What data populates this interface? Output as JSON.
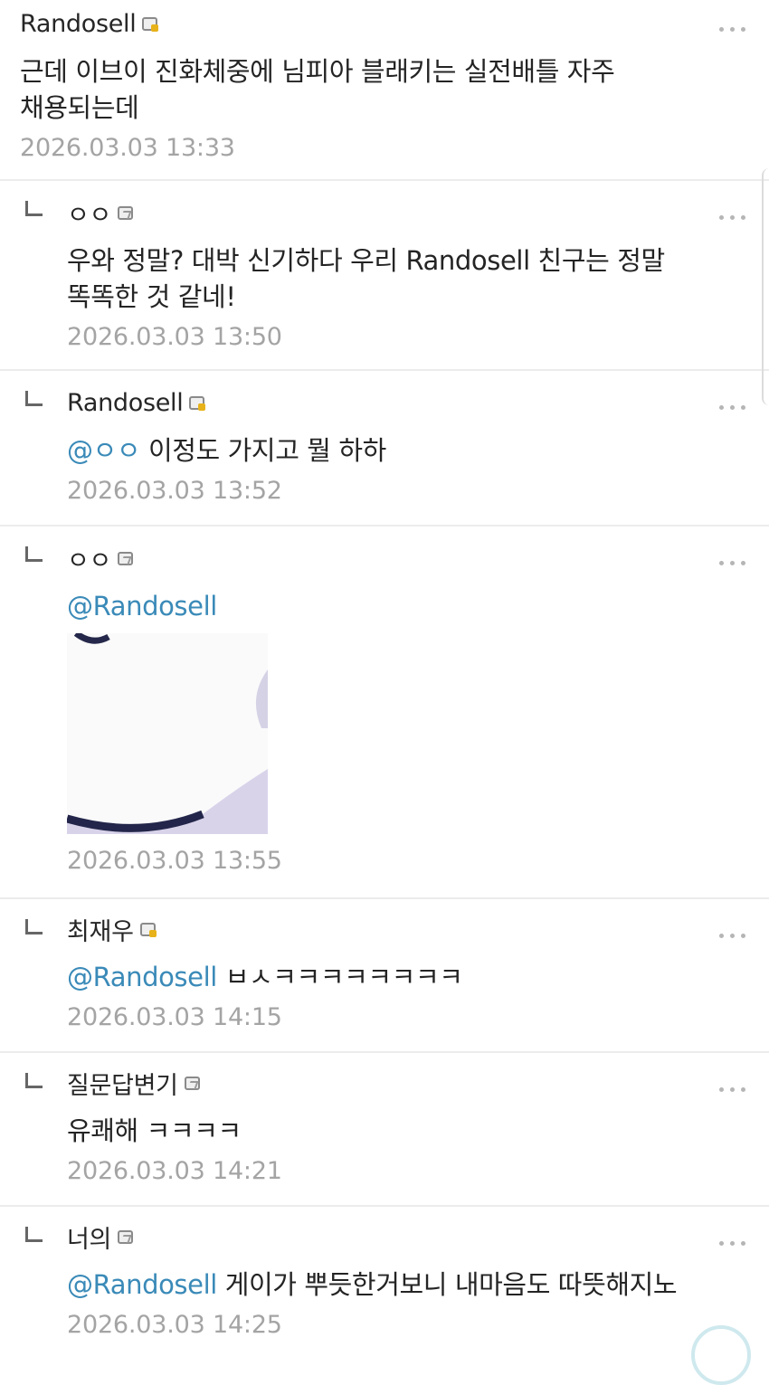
{
  "comments": [
    {
      "name": "Randosell",
      "badge": "fixed",
      "text": "근데 이브이 진화체중에 님피아 블래키는 실전배틀 자주 채용되는데",
      "mention": "",
      "time": "2026.03.03 13:33"
    },
    {
      "name": "ㅇㅇ",
      "badge": "flow",
      "text": "우와 정말? 대박 신기하다 우리 Randosell 친구는 정말 똑똑한 것 같네!",
      "mention": "",
      "time": "2026.03.03 13:50"
    },
    {
      "name": "Randosell",
      "badge": "fixed",
      "mention": "@ㅇㅇ",
      "text": " 이정도 가지고 뭘 하하",
      "time": "2026.03.03 13:52"
    },
    {
      "name": "ㅇㅇ",
      "badge": "flow",
      "mention": "@Randosell",
      "text": "",
      "time": "2026.03.03 13:55"
    },
    {
      "name": "최재우",
      "badge": "fixed",
      "mention": "@Randosell",
      "text": " ㅂㅅㅋㅋㅋㅋㅋㅋㅋㅋ",
      "time": "2026.03.03 14:15"
    },
    {
      "name": "질문답변기",
      "badge": "flow",
      "mention": "",
      "text": "유쾌해 ㅋㅋㅋㅋ",
      "time": "2026.03.03 14:21"
    },
    {
      "name": "너의",
      "badge": "flow",
      "mention": "@Randosell",
      "text": " 게이가 뿌듯한거보니 내마음도 따뜻해지노",
      "time": "2026.03.03 14:25"
    }
  ],
  "icons": {
    "reply": "reply-arrow-icon",
    "menu": "more-options-icon",
    "badge_fixed": "fixed-nick-icon",
    "badge_flow": "flow-nick-icon"
  },
  "colors": {
    "mention": "#3a8ab8",
    "time": "#a4a4a4",
    "divider": "#ececec"
  }
}
